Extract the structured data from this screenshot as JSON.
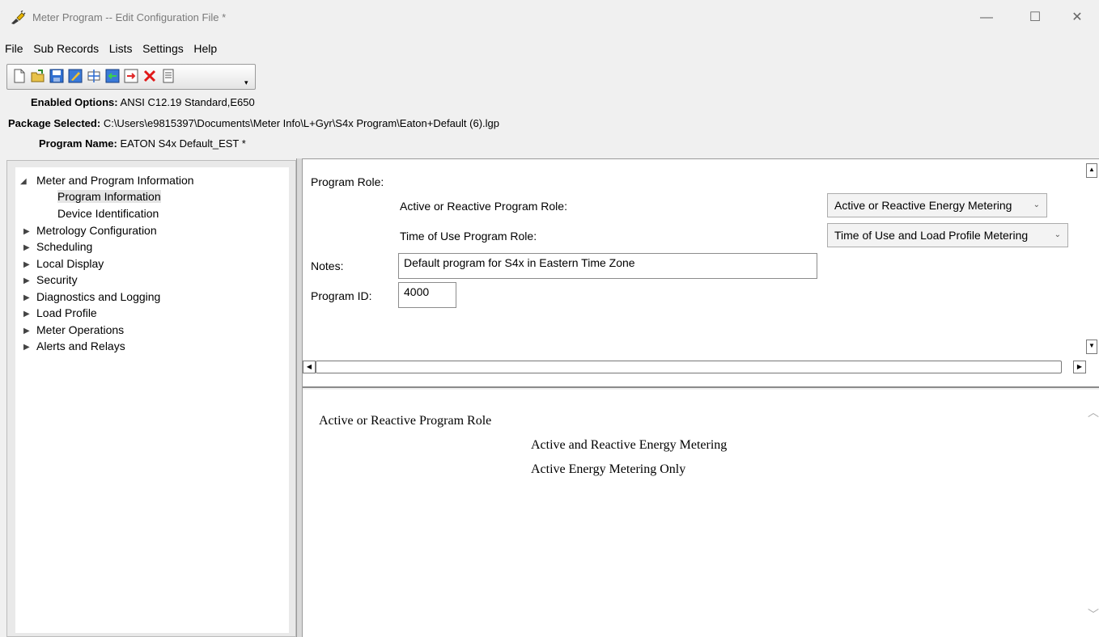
{
  "window": {
    "title": "Meter Program -- Edit Configuration File *",
    "minimize_glyph": "—",
    "maximize_glyph": "☐",
    "close_glyph": "✕"
  },
  "menu": [
    "File",
    "Sub Records",
    "Lists",
    "Settings",
    "Help"
  ],
  "toolbar": {
    "icons": [
      "new-icon",
      "open-icon",
      "save-icon",
      "edit-icon",
      "insert-icon",
      "import-icon",
      "export-icon",
      "delete-icon",
      "properties-icon"
    ],
    "dropdown_glyph": "▾"
  },
  "info": {
    "enabled_options_label": "Enabled Options:",
    "enabled_options_value": "ANSI C12.19 Standard,E650",
    "package_label": "Package Selected:",
    "package_value": "C:\\Users\\e9815397\\Documents\\Meter Info\\L+Gyr\\S4x Program\\Eaton+Default (6).lgp",
    "program_name_label": "Program Name:",
    "program_name_value": "EATON S4x Default_EST *"
  },
  "tree": {
    "expanded_glyph": "◢",
    "collapsed_glyph": "▶",
    "items": [
      {
        "label": "Meter and Program Information"
      },
      {
        "label": "Program Information"
      },
      {
        "label": "Device Identification"
      },
      {
        "label": "Metrology Configuration"
      },
      {
        "label": "Scheduling"
      },
      {
        "label": "Local Display"
      },
      {
        "label": "Security"
      },
      {
        "label": "Diagnostics and Logging"
      },
      {
        "label": "Load Profile"
      },
      {
        "label": "Meter Operations"
      },
      {
        "label": "Alerts and Relays"
      }
    ]
  },
  "form": {
    "program_role_label": "Program Role:",
    "active_reactive_label": "Active or Reactive Program Role:",
    "active_reactive_value": "Active or Reactive Energy Metering",
    "tou_label": "Time of Use Program Role:",
    "tou_value": "Time of Use and Load Profile Metering",
    "notes_label": "Notes:",
    "notes_value": "Default program for S4x in Eastern Time Zone",
    "program_id_label": "Program ID:",
    "program_id_value": "4000",
    "chevron_glyph": "⌄"
  },
  "help": {
    "heading": "Active or Reactive Program Role",
    "options": [
      "Active and Reactive Energy Metering",
      "Active Energy Metering Only"
    ]
  }
}
